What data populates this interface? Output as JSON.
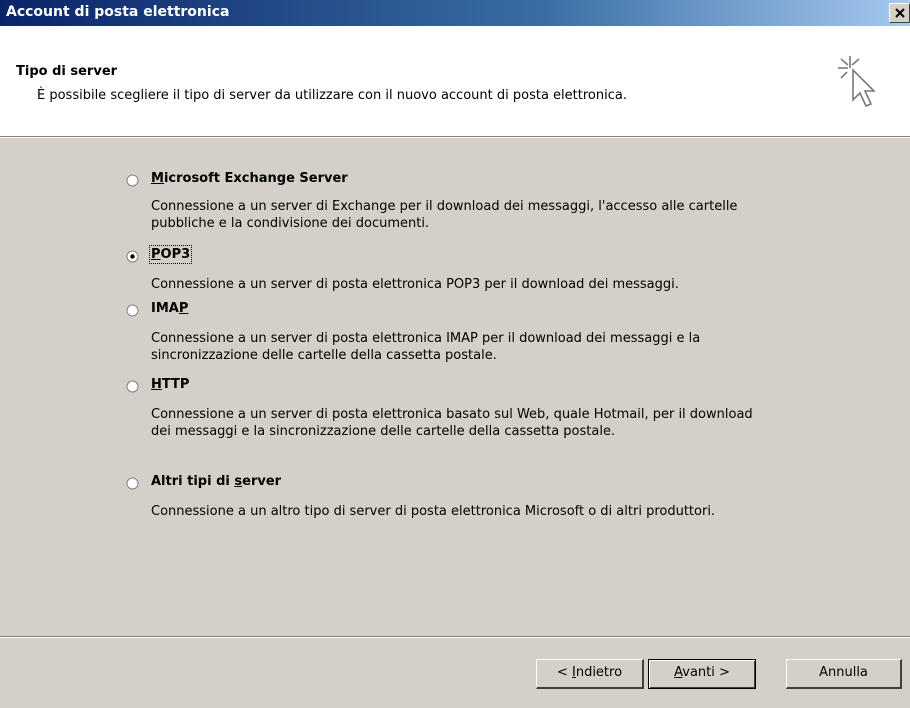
{
  "window": {
    "title": "Account di posta elettronica",
    "close_icon": "close-x-icon"
  },
  "header": {
    "title": "Tipo di server",
    "subtitle": "È possibile scegliere il tipo di server da utilizzare con il nuovo account di posta elettronica.",
    "icon": "wizard-cursor-sparkle-icon"
  },
  "options": [
    {
      "label_pre": "",
      "label_u": "M",
      "label_post": "icrosoft Exchange Server",
      "description": "Connessione a un server di Exchange per il download dei messaggi, l'accesso alle cartelle pubbliche e la condivisione dei documenti.",
      "selected": false
    },
    {
      "label_pre": "",
      "label_u": "P",
      "label_post": "OP3",
      "description": "Connessione a un server di posta elettronica POP3 per il download dei messaggi.",
      "selected": true
    },
    {
      "label_pre": "IMA",
      "label_u": "P",
      "label_post": "",
      "description": "Connessione a un server di posta elettronica IMAP per il download dei messaggi e la sincronizzazione delle cartelle della cassetta postale.",
      "selected": false
    },
    {
      "label_pre": "",
      "label_u": "H",
      "label_post": "TTP",
      "description": "Connessione a un server di posta elettronica basato sul Web, quale Hotmail, per il download dei messaggi e la sincronizzazione delle cartelle della cassetta postale.",
      "selected": false
    },
    {
      "label_pre": "Altri tipi di ",
      "label_u": "s",
      "label_post": "erver",
      "description": "Connessione a un altro tipo di server di posta elettronica Microsoft o di altri produttori.",
      "selected": false
    }
  ],
  "buttons": {
    "back": {
      "pre": "< ",
      "u": "I",
      "post": "ndietro"
    },
    "next": {
      "pre": "",
      "u": "A",
      "post": "vanti >"
    },
    "cancel": "Annulla"
  }
}
